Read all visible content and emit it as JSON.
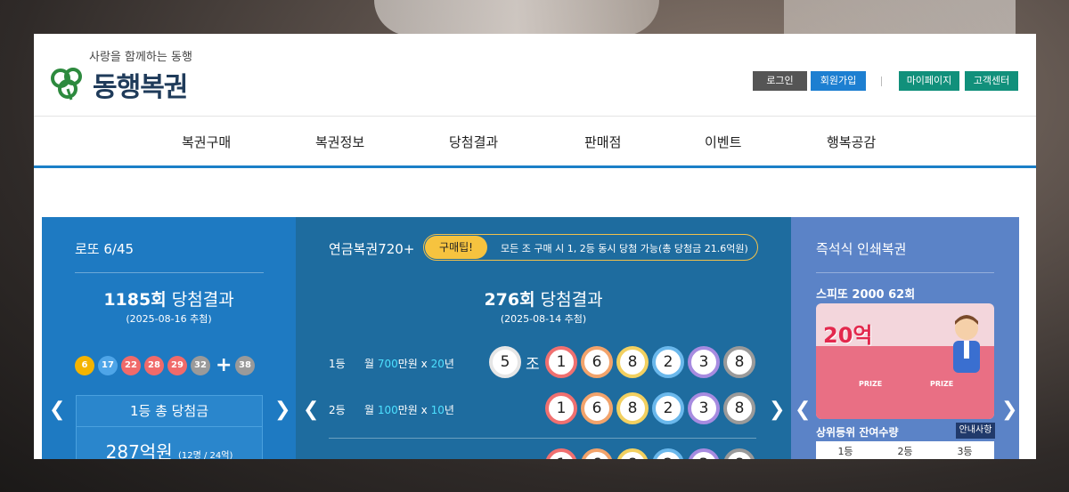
{
  "brand": {
    "tagline": "사랑을 함께하는 동행",
    "name": "동행복권",
    "colors": {
      "green": "#2d8a3e",
      "navy": "#1f3b5a"
    }
  },
  "util_nav": {
    "login": "로그인",
    "join": "회원가입",
    "mypage": "마이페이지",
    "cs": "고객센터"
  },
  "gnb": [
    "복권구매",
    "복권정보",
    "당첨결과",
    "판매점",
    "이벤트",
    "행복공감"
  ],
  "lotto": {
    "title": "로또 6/45",
    "draw_no": "1185회",
    "result_label": "당첨결과",
    "date": "(2025-08-16 추첨)",
    "numbers": [
      {
        "n": "6",
        "color": "#f4b400"
      },
      {
        "n": "17",
        "color": "#4ea5e8"
      },
      {
        "n": "22",
        "color": "#f06a6a"
      },
      {
        "n": "28",
        "color": "#f06a6a"
      },
      {
        "n": "29",
        "color": "#f06a6a"
      },
      {
        "n": "32",
        "color": "#9a9a9a"
      }
    ],
    "plus": "+",
    "bonus": {
      "n": "38",
      "color": "#9a9a9a"
    },
    "first_prize_label": "1등 총 당첨금",
    "first_prize_amount": "287억원",
    "first_prize_detail": "(12명 / 24억)"
  },
  "pension": {
    "title": "연금복권720+",
    "tip_label": "구매팁!",
    "tip_text": "모든 조 구매 시 1, 2등 동시 당첨 가능(총 당첨금 21.6억원)",
    "draw_no": "276회",
    "result_label": "당첨결과",
    "date": "(2025-08-14 추첨)",
    "rank1": {
      "label": "1등",
      "monthly_pre": "월 ",
      "monthly_amt": "700",
      "monthly_mid": "만원 x ",
      "years": "20",
      "monthly_post": "년"
    },
    "rank2": {
      "label": "2등",
      "monthly_pre": "월 ",
      "monthly_amt": "100",
      "monthly_mid": "만원 x ",
      "years": "10",
      "monthly_post": "년"
    },
    "group": "5",
    "group_unit": "조",
    "digits": [
      "1",
      "6",
      "8",
      "2",
      "3",
      "8"
    ],
    "digit_colors": [
      "#f07070",
      "#f2a36b",
      "#f2d060",
      "#6ab8ec",
      "#a78be0",
      "#9a9a9a"
    ]
  },
  "instant": {
    "title": "즉석식 인쇄복권",
    "product": "스피또 2000 62회",
    "ticket_big": "20억",
    "ticket_prize": "PRIZE",
    "remaining_label": "상위등위 잔여수량",
    "notice": "안내사항",
    "columns": [
      "1등",
      "2등",
      "3등"
    ]
  }
}
